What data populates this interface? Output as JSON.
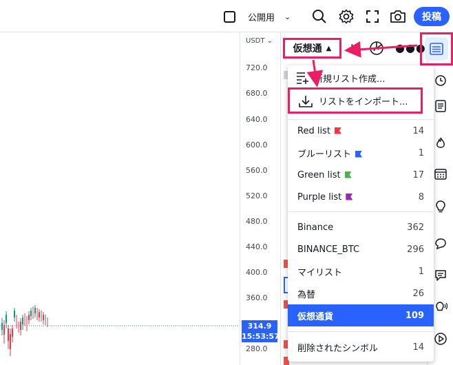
{
  "toolbar": {
    "visibility_label": "公開用",
    "post_label": "投稿",
    "icons": [
      "square-icon",
      "search-icon",
      "gear-icon",
      "fullscreen-icon",
      "camera-icon"
    ]
  },
  "price_axis": {
    "unit": "USDT",
    "ticks": [
      "720.0",
      "680.0",
      "640.0",
      "600.0",
      "560.0",
      "520.0",
      "480.0",
      "440.0",
      "400.0",
      "360.0",
      "280.0"
    ],
    "last_price": "314.9",
    "countdown": "15:53:57"
  },
  "panel": {
    "current_list": "仮想通"
  },
  "menu": {
    "new_list": "新規リスト作成...",
    "import_list": "リストをインポート...",
    "flag_lists": [
      {
        "label": "Red list",
        "count": "14",
        "color": "#f23645"
      },
      {
        "label": "ブルーリスト",
        "count": "1",
        "color": "#2962ff"
      },
      {
        "label": "Green list",
        "count": "17",
        "color": "#4caf50"
      },
      {
        "label": "Purple list",
        "count": "8",
        "color": "#9c27b0"
      }
    ],
    "lists": [
      {
        "label": "Binance",
        "count": "362"
      },
      {
        "label": "BINANCE_BTC",
        "count": "296"
      },
      {
        "label": "マイリスト",
        "count": "1"
      },
      {
        "label": "為替",
        "count": "26"
      },
      {
        "label": "仮想通貨",
        "count": "109"
      }
    ],
    "deleted": {
      "label": "削除されたシンボル",
      "count": "14"
    }
  },
  "colors": {
    "accent": "#2962ff",
    "highlight": "#e91e63",
    "selected_row": "#2962ff"
  }
}
